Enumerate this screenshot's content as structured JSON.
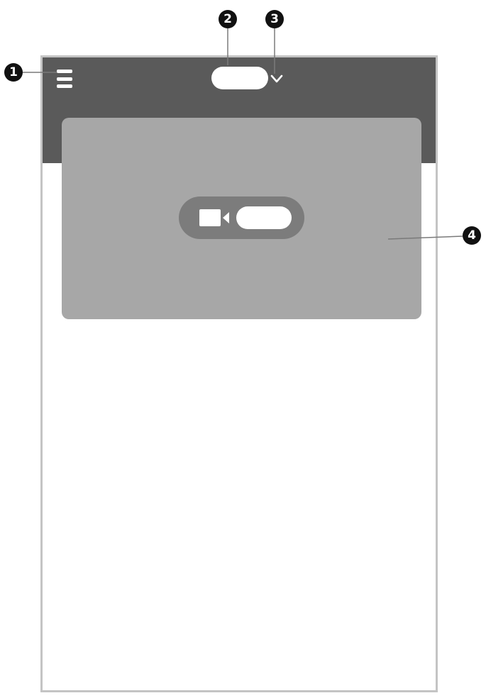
{
  "callouts": [
    {
      "number": "1",
      "target": "menu-icon"
    },
    {
      "number": "2",
      "target": "title-pill"
    },
    {
      "number": "3",
      "target": "chevron-down-icon"
    },
    {
      "number": "4",
      "target": "hero-card"
    }
  ],
  "icons": {
    "menu": "menu-icon",
    "dropdown": "chevron-down-icon",
    "video": "video-camera-icon"
  },
  "colors": {
    "header": "#5a5a5a",
    "card": "#a7a7a7",
    "join_button": "#7c7c7c",
    "callout_badge": "#111111",
    "frame_border": "#c4c4c4"
  }
}
